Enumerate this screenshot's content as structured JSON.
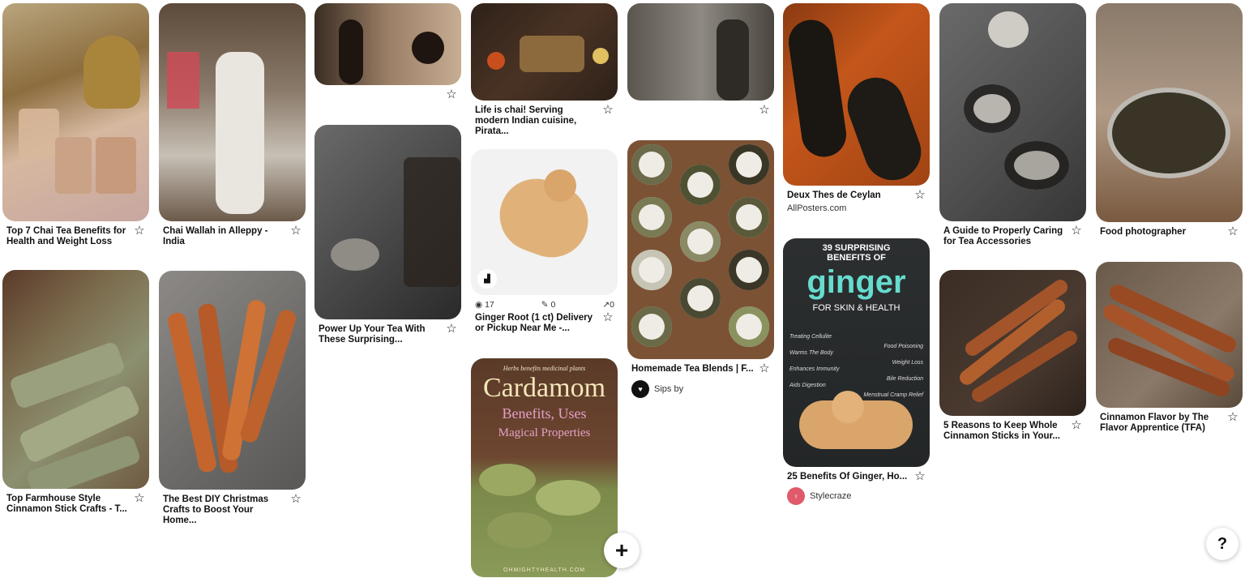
{
  "pins": [
    {
      "title": "Top 7 Chai Tea Benefits for Health and Weight Loss"
    },
    {
      "title": "Top Farmhouse Style Cinnamon Stick Crafts - T..."
    },
    {
      "title": "Chai Wallah in Alleppy - India"
    },
    {
      "title": "The Best DIY Christmas Crafts to Boost Your Home..."
    },
    {
      "title": ""
    },
    {
      "title": "Power Up Your Tea With These Surprising..."
    },
    {
      "title": "Life is chai! Serving modern Indian cuisine, Pirata..."
    },
    {
      "title": "Ginger Root (1 ct) Delivery or Pickup Near Me -...",
      "stats": {
        "views": "17",
        "saves": "0",
        "clicks": "0"
      }
    },
    {
      "title": "",
      "overlay": {
        "top": "Herbs benefits medicinal plants",
        "heading": "Cardamom",
        "line1": "Benefits, Uses",
        "line2": "Magical Properties",
        "footer": "OHMIGHTYHEALTH.COM"
      }
    },
    {
      "title": ""
    },
    {
      "title": "Homemade Tea Blends | F...",
      "source": "Sips by",
      "source_avatar": "tea"
    },
    {
      "title": "Deux Thes de Ceylan",
      "source": "AllPosters.com"
    },
    {
      "title": "25 Benefits Of Ginger, Ho...",
      "source": "Stylecraze",
      "overlay": {
        "top": "39 SURPRISING BENEFITS OF",
        "heading": "ginger",
        "sub": "FOR SKIN & HEALTH",
        "left": [
          "Treating Cellulite",
          "Warms The Body",
          "Enhances Immunity",
          "Aids Digestion"
        ],
        "right": [
          "Food Poisoning",
          "Weight Loss",
          "Bile Reduction",
          "Menstrual Cramp Relief"
        ]
      }
    },
    {
      "title": "A Guide to Properly Caring for Tea Accessories"
    },
    {
      "title": "5 Reasons to Keep Whole Cinnamon Sticks in Your..."
    },
    {
      "title": "Food photographer"
    },
    {
      "title": "Cinnamon Flavor by The Flavor Apprentice (TFA)"
    }
  ],
  "help_label": "?",
  "add_label": "+"
}
